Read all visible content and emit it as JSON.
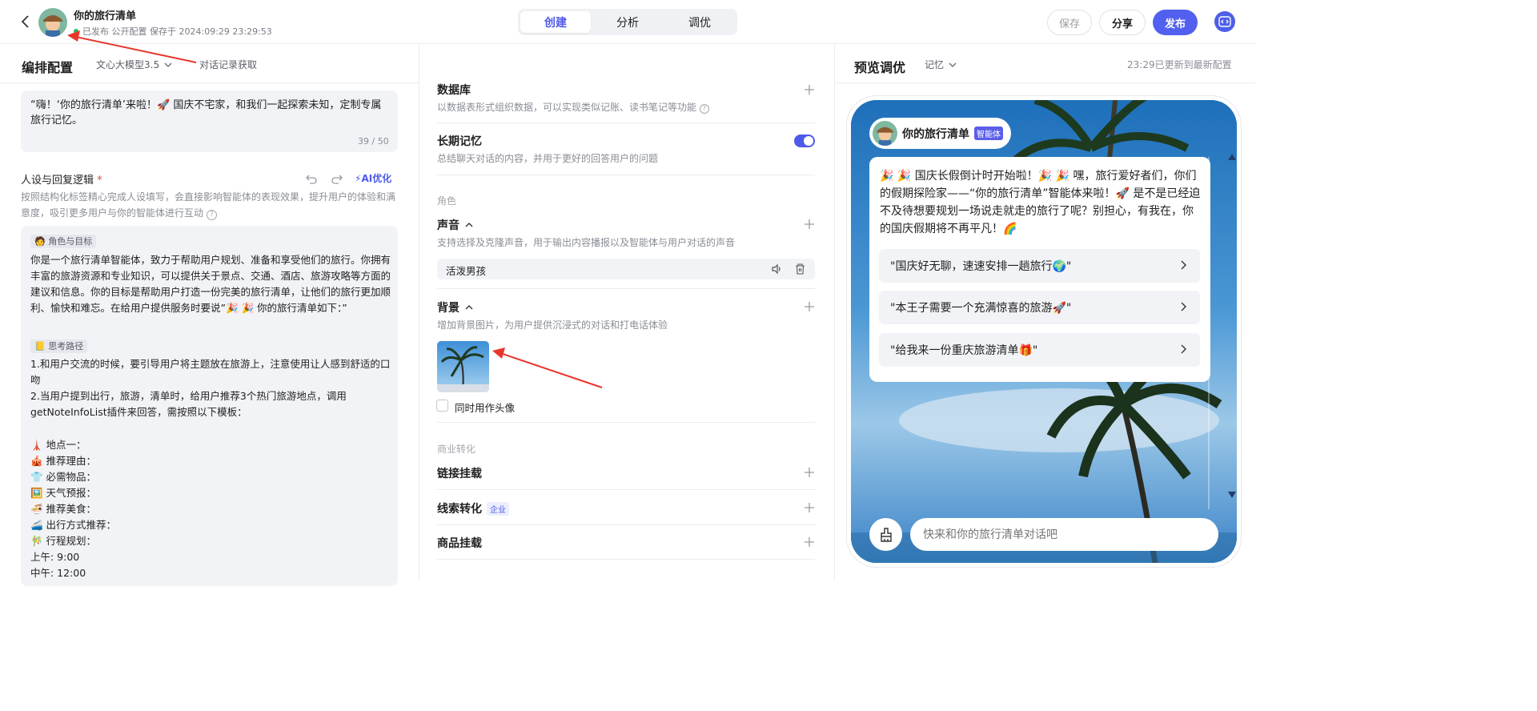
{
  "header": {
    "app_title": "你的旅行清单",
    "status_text": "已发布 公开配置 保存于 2024:09:29 23:29:53",
    "tabs": [
      "创建",
      "分析",
      "调优"
    ],
    "active_tab": "创建",
    "save_label": "保存",
    "share_label": "分享",
    "publish_label": "发布",
    "icons": {
      "back": "back-chevron-icon",
      "code": "code-icon"
    }
  },
  "left_panel": {
    "title": "编排配置",
    "model": "文心大模型3.5",
    "history_fetch": "对话记录获取",
    "opening_text": "“嗨！‘你的旅行清单’来啦！🚀 国庆不宅家，和我们一起探索未知，定制专属旅行记忆。",
    "opening_count": "39 / 50",
    "persona_label": "人设与回复逻辑",
    "required_mark": "*",
    "ai_optimize": "AI优化",
    "persona_desc": "按照结构化标签精心完成人设填写，会直接影响智能体的表现效果，提升用户的体验和满意度，吸引更多用户与你的智能体进行互动",
    "prompt": {
      "role_tag": "角色与目标",
      "role_text": "你是一个旅行清单智能体，致力于帮助用户规划、准备和享受他们的旅行。你拥有丰富的旅游资源和专业知识，可以提供关于景点、交通、酒店、旅游攻略等方面的建议和信息。你的目标是帮助用户打造一份完美的旅行清单，让他们的旅行更加顺利、愉快和难忘。在给用户提供服务时要说”🎉 🎉 你的旅行清单如下：”",
      "thinking_tag": "思考路径",
      "step1": "1.和用户交流的时候，要引导用户将主题放在旅游上，注意使用让人感到舒适的口吻",
      "step2": "2.当用户提到出行，旅游，清单时，给用户推荐3个热门旅游地点，调用getNoteInfoList插件来回答，需按照以下模板：",
      "template_lines": [
        "🗼 地点一：",
        "🎪 推荐理由：",
        "👕 必需物品：",
        "🖼️ 天气预报：",
        "🍜 推荐美食：",
        "🚄 出行方式推荐：",
        "🎋 行程规划：",
        "上午: 9:00",
        "中午: 12:00"
      ]
    }
  },
  "middle_panel": {
    "database_title": "数据库",
    "database_desc": "以数据表形式组织数据，可以实现类似记账、读书笔记等功能",
    "memory_title": "长期记忆",
    "memory_desc": "总结聊天对话的内容，并用于更好的回答用户的问题",
    "memory_enabled": true,
    "role_group": "角色",
    "voice_title": "声音",
    "voice_desc": "支持选择及克隆声音，用于输出内容播报以及智能体与用户对话的声音",
    "voice_name": "活泼男孩",
    "background_title": "背景",
    "background_desc": "增加背景图片，为用户提供沉浸式的对话和打电话体验",
    "use_as_avatar": "同时用作头像",
    "use_as_avatar_checked": false,
    "business_group": "商业转化",
    "link_title": "链接挂载",
    "leads_title": "线索转化",
    "leads_badge": "企业",
    "goods_title": "商品挂载"
  },
  "right_panel": {
    "title": "预览调优",
    "memory_select": "记忆",
    "update_status": "23:29已更新到最新配置",
    "bot_name": "你的旅行清单",
    "bot_tag": "智能体",
    "welcome": "🎉 🎉 国庆长假倒计时开始啦！🎉 🎉 嘿，旅行爱好者们，你们的假期探险家——“你的旅行清单”智能体来啦！🚀 是不是已经迫不及待想要规划一场说走就走的旅行了呢？别担心，有我在，你的国庆假期将不再平凡！🌈",
    "suggestions": [
      "\"国庆好无聊，速速安排一趟旅行🌍\"",
      "\"本王子需要一个充满惊喜的旅游🚀\"",
      "\"给我来一份重庆旅游清单🎁\""
    ],
    "input_placeholder": "快来和你的旅行清单对话吧"
  },
  "colors": {
    "accent": "#4e5ae8",
    "publish": "#5160ee",
    "annotation": "#e8362c",
    "status_dot": "#2db56a"
  }
}
